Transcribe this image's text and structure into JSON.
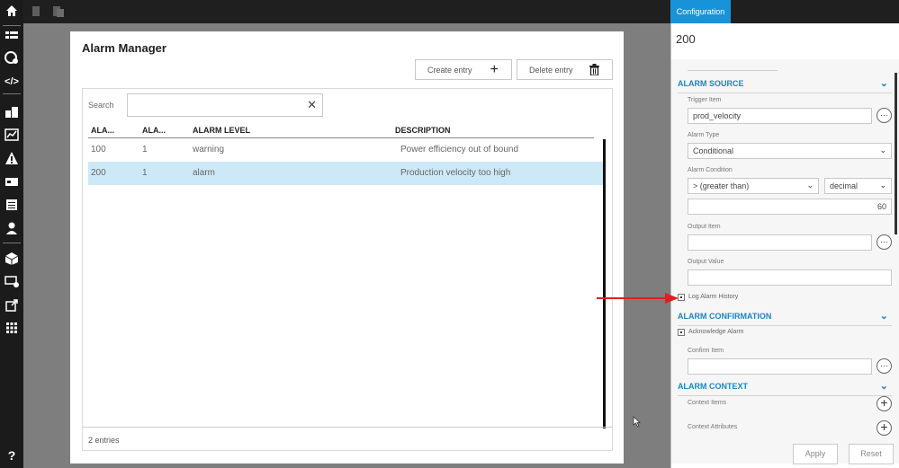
{
  "card": {
    "title": "Alarm Manager",
    "create_label": "Create entry",
    "delete_label": "Delete entry",
    "search_label": "Search",
    "search_value": ""
  },
  "table": {
    "columns": [
      "ALA...",
      "ALA...",
      "ALARM LEVEL",
      "DESCRIPTION"
    ],
    "rows": [
      [
        "100",
        "1",
        "warning",
        "Power efficiency out of bound"
      ],
      [
        "200",
        "1",
        "alarm",
        "Production velocity too high"
      ]
    ],
    "count_text": "2 entries"
  },
  "panel": {
    "tab": "Configuration",
    "id": "200",
    "alarm_source": {
      "header": "ALARM SOURCE",
      "trigger_item_label": "Trigger Item",
      "trigger_item_value": "prod_velocity",
      "alarm_type_label": "Alarm Type",
      "alarm_type_value": "Conditional",
      "alarm_condition_label": "Alarm Condition",
      "condition_operator": "> (greater than)",
      "condition_type": "decimal",
      "condition_value": "60",
      "output_item_label": "Output Item",
      "output_value_label": "Output Value",
      "log_history_label": "Log Alarm History"
    },
    "alarm_confirmation": {
      "header": "ALARM CONFIRMATION",
      "ack_label": "Acknowledge Alarm",
      "confirm_item_label": "Confirm Item"
    },
    "alarm_context": {
      "header": "ALARM CONTEXT",
      "context_items_label": "Context Items",
      "context_attributes_label": "Context Attributes"
    },
    "apply_label": "Apply",
    "reset_label": "Reset"
  },
  "colors": {
    "accent": "#1893d7",
    "selected_row": "#cde9f7",
    "arrow": "#e02020"
  }
}
